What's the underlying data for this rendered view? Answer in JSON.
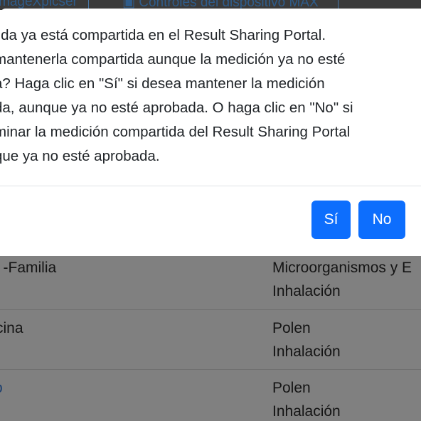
{
  "toolbar": {
    "item1_label": "mageXpicser",
    "item2_label": "Controles del dispositivo MAX"
  },
  "dialog": {
    "message_lines": [
      "lida ya está compartida en el Result Sharing Portal.",
      "mantenerla compartida aunque la medición ya no esté",
      "a? Haga clic en \"Sí\" si desea mantener la medición",
      "da, aunque ya no esté aprobada. O haga clic en \"No\" si",
      "minar la medición compartida del Result Sharing Portal",
      "que ya no esté aprobada."
    ],
    "yes_label": "Sí",
    "no_label": "No"
  },
  "table": {
    "rows": [
      {
        "name": "l -Familia",
        "category": "Microorganismos y E",
        "route": "Inhalación"
      },
      {
        "name": "cina",
        "category": "Polen",
        "route": "Inhalación"
      },
      {
        "name": "o",
        "category": "Polen",
        "route": "Inhalación"
      }
    ]
  },
  "colors": {
    "primary_button": "#0d6efd",
    "overlay_table": "#808080"
  }
}
